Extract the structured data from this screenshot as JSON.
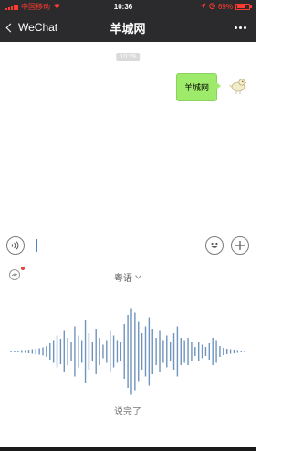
{
  "status_bar": {
    "carrier": "中国移动",
    "time": "10:36",
    "battery_percent": "69%",
    "battery_level": 0.69
  },
  "nav": {
    "back_label": "WeChat",
    "title": "羊城网"
  },
  "chat": {
    "timestamp": "10:29",
    "message": "羊城网"
  },
  "voice_input": {
    "language": "粤语",
    "done_label": "说完了",
    "waveform_amplitudes": [
      0.02,
      0.02,
      0.02,
      0.03,
      0.03,
      0.04,
      0.05,
      0.06,
      0.07,
      0.09,
      0.12,
      0.18,
      0.25,
      0.35,
      0.28,
      0.45,
      0.3,
      0.2,
      0.55,
      0.35,
      0.25,
      0.7,
      0.4,
      0.2,
      0.5,
      0.3,
      0.15,
      0.25,
      0.45,
      0.35,
      0.25,
      0.2,
      0.6,
      0.8,
      0.95,
      0.85,
      0.65,
      0.4,
      0.55,
      0.75,
      0.5,
      0.3,
      0.45,
      0.25,
      0.35,
      0.2,
      0.4,
      0.55,
      0.3,
      0.25,
      0.3,
      0.2,
      0.1,
      0.2,
      0.15,
      0.1,
      0.18,
      0.3,
      0.25,
      0.12,
      0.08,
      0.06,
      0.05,
      0.04,
      0.03,
      0.02,
      0.02
    ],
    "waveform_color": "#6f94be"
  },
  "colors": {
    "header_bg": "#2b2b2d",
    "bubble_bg": "#9eea6a",
    "status_accent": "#ff3b30"
  },
  "icons": {
    "back": "chevron-left-icon",
    "more": "more-dots-icon",
    "voice_toggle": "voice-icon",
    "emoji": "emoji-icon",
    "add": "plus-icon",
    "settings": "voice-settings-icon",
    "avatar": "bird-avatar"
  }
}
